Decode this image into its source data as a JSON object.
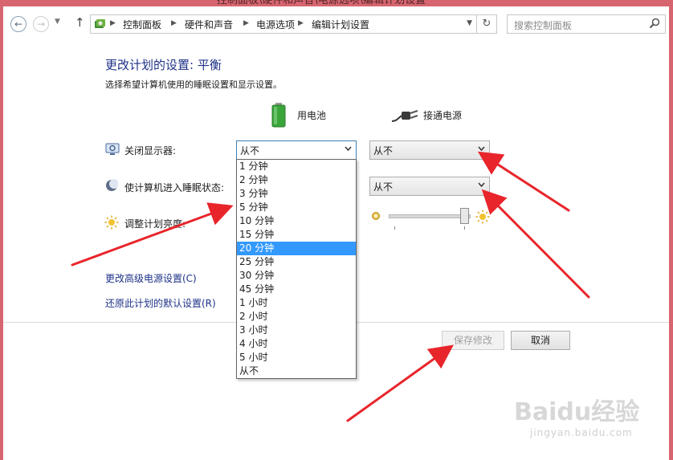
{
  "window": {
    "title": "控制面板\\硬件和声音\\电源选项\\编辑计划设置"
  },
  "address_bar": {
    "breadcrumbs": [
      "控制面板",
      "硬件和声音",
      "电源选项",
      "编辑计划设置"
    ]
  },
  "search": {
    "placeholder": "搜索控制面板"
  },
  "page": {
    "title": "更改计划的设置: 平衡",
    "subtitle": "选择希望计算机使用的睡眠设置和显示设置。"
  },
  "columns": {
    "battery": "用电池",
    "plugged_in": "接通电源"
  },
  "settings": {
    "display_off": {
      "label": "关闭显示器:",
      "battery_value": "从不",
      "plugged_value": "从不"
    },
    "sleep": {
      "label": "使计算机进入睡眠状态:",
      "plugged_value": "从不"
    },
    "brightness": {
      "label": "调整计划亮度:",
      "plugged_level": 1.0
    }
  },
  "dropdown_options": [
    "1 分钟",
    "2 分钟",
    "3 分钟",
    "5 分钟",
    "10 分钟",
    "15 分钟",
    "20 分钟",
    "25 分钟",
    "30 分钟",
    "45 分钟",
    "1 小时",
    "2 小时",
    "3 小时",
    "4 小时",
    "5 小时",
    "从不"
  ],
  "dropdown_highlighted": "20 分钟",
  "links": {
    "advanced": "更改高级电源设置(C)",
    "restore": "还原此计划的默认设置(R)"
  },
  "buttons": {
    "save": "保存修改",
    "cancel": "取消"
  },
  "watermark": {
    "brand": "Baidu经验",
    "url": "jingyan.baidu.com"
  },
  "colors": {
    "accent": "#1e3287",
    "highlight": "#3399ff",
    "annotation_arrow": "#e8252b",
    "frame": "#d6656f"
  },
  "icons": {
    "back": "back-arrow-icon",
    "forward": "forward-arrow-icon",
    "up": "up-arrow-icon",
    "control_panel": "control-panel-icon",
    "battery": "battery-icon",
    "plug": "power-plug-icon",
    "monitor": "monitor-icon",
    "sleep": "moon-icon",
    "brightness": "sun-icon"
  }
}
